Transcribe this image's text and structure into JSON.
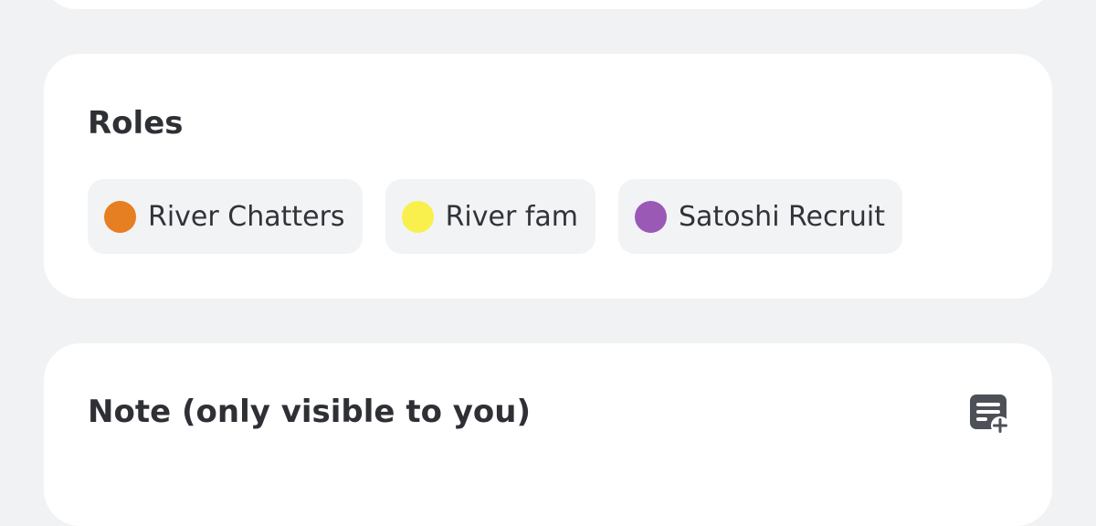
{
  "roles_section": {
    "title": "Roles",
    "roles": [
      {
        "label": "River Chatters",
        "color": "#e67e22"
      },
      {
        "label": "River fam",
        "color": "#f9f04d"
      },
      {
        "label": "Satoshi Recruit",
        "color": "#9b59b6"
      }
    ]
  },
  "note_section": {
    "title": "Note (only visible to you)",
    "action_icon": "note-add-icon"
  },
  "colors": {
    "background": "#f1f2f4",
    "card": "#ffffff",
    "pill": "#f2f3f5",
    "text": "#313338",
    "icon": "#4e5058"
  }
}
